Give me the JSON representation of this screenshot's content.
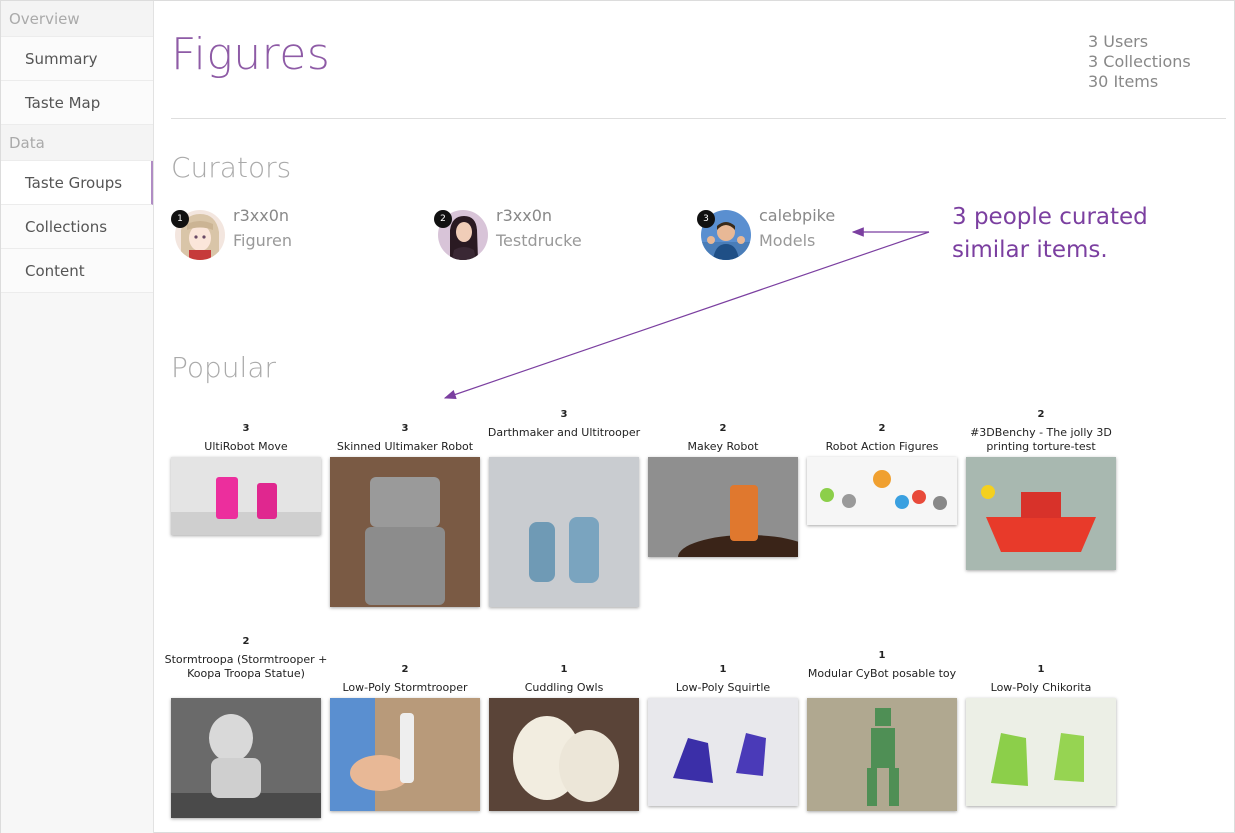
{
  "sidebar": {
    "sections": [
      {
        "label": "Overview",
        "items": [
          "Summary",
          "Taste Map"
        ]
      },
      {
        "label": "Data",
        "items": [
          "Taste Groups",
          "Collections",
          "Content"
        ]
      }
    ],
    "active": "Taste Groups"
  },
  "page": {
    "title": "Figures",
    "stats": {
      "users": "3 Users",
      "collections": "3 Collections",
      "items": "30 Items"
    }
  },
  "curators": {
    "heading": "Curators",
    "list": [
      {
        "rank": "1",
        "name": "r3xx0n",
        "collection": "Figuren"
      },
      {
        "rank": "2",
        "name": "r3xx0n",
        "collection": "Testdrucke"
      },
      {
        "rank": "3",
        "name": "calebpike",
        "collection": "Models"
      }
    ]
  },
  "annotation": {
    "text": "3 people curated similar items."
  },
  "popular": {
    "heading": "Popular",
    "items": [
      {
        "count": "3",
        "title": "UltiRobot Move",
        "color": "#ec2e9d"
      },
      {
        "count": "3",
        "title": "Skinned Ultimaker Robot",
        "color": "#8c8c8c"
      },
      {
        "count": "3",
        "title": "Darthmaker and Ultitrooper",
        "color": "#6f9ab5"
      },
      {
        "count": "2",
        "title": "Makey Robot",
        "color": "#e0782e"
      },
      {
        "count": "2",
        "title": "Robot Action Figures",
        "color": "#f0b23a"
      },
      {
        "count": "2",
        "title": "#3DBenchy - The jolly 3D printing torture-test",
        "color": "#e83a2a"
      },
      {
        "count": "2",
        "title": "Stormtroopa (Stormtrooper + Koopa Troopa Statue)",
        "color": "#d9d9d9"
      },
      {
        "count": "2",
        "title": "Low-Poly Stormtrooper",
        "color": "#eeeeee"
      },
      {
        "count": "1",
        "title": "Cuddling Owls",
        "color": "#f2ede0"
      },
      {
        "count": "1",
        "title": "Low-Poly Squirtle",
        "color": "#3b2fa8"
      },
      {
        "count": "1",
        "title": "Modular CyBot posable toy",
        "color": "#4f8f55"
      },
      {
        "count": "1",
        "title": "Low-Poly Chikorita",
        "color": "#8ccf4a"
      }
    ]
  }
}
